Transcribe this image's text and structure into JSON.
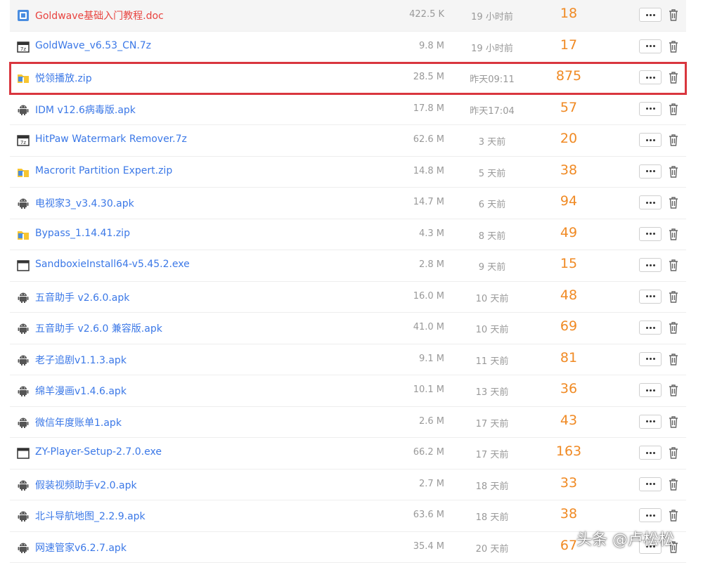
{
  "files": [
    {
      "name": "Goldwave基础入门教程.doc",
      "size": "422.5 K",
      "time": "19 小时前",
      "count": "18",
      "icon": "doc-icon",
      "color": "red"
    },
    {
      "name": "GoldWave_v6.53_CN.7z",
      "size": "9.8 M",
      "time": "19 小时前",
      "count": "17",
      "icon": "archive-7z-icon"
    },
    {
      "name": "悦领播放.zip",
      "size": "28.5 M",
      "time": "昨天09:11",
      "count": "875",
      "icon": "zip-folder-icon",
      "highlighted": true
    },
    {
      "name": "IDM v12.6病毒版.apk",
      "size": "17.8 M",
      "time": "昨天17:04",
      "count": "57",
      "icon": "android-icon"
    },
    {
      "name": "HitPaw Watermark Remover.7z",
      "size": "62.6 M",
      "time": "3 天前",
      "count": "20",
      "icon": "archive-7z-icon"
    },
    {
      "name": "Macrorit Partition Expert.zip",
      "size": "14.8 M",
      "time": "5 天前",
      "count": "38",
      "icon": "zip-folder-icon"
    },
    {
      "name": "电视家3_v3.4.30.apk",
      "size": "14.7 M",
      "time": "6 天前",
      "count": "94",
      "icon": "android-icon"
    },
    {
      "name": "Bypass_1.14.41.zip",
      "size": "4.3 M",
      "time": "8 天前",
      "count": "49",
      "icon": "zip-folder-icon"
    },
    {
      "name": "SandboxieInstall64-v5.45.2.exe",
      "size": "2.8 M",
      "time": "9 天前",
      "count": "15",
      "icon": "exe-window-icon"
    },
    {
      "name": "五音助手 v2.6.0.apk",
      "size": "16.0 M",
      "time": "10 天前",
      "count": "48",
      "icon": "android-icon"
    },
    {
      "name": "五音助手 v2.6.0 兼容版.apk",
      "size": "41.0 M",
      "time": "10 天前",
      "count": "69",
      "icon": "android-icon"
    },
    {
      "name": "老子追剧v1.1.3.apk",
      "size": "9.1 M",
      "time": "11 天前",
      "count": "81",
      "icon": "android-icon"
    },
    {
      "name": "绵羊漫画v1.4.6.apk",
      "size": "10.1 M",
      "time": "13 天前",
      "count": "36",
      "icon": "android-icon"
    },
    {
      "name": "微信年度账单1.apk",
      "size": "2.6 M",
      "time": "17 天前",
      "count": "43",
      "icon": "android-icon"
    },
    {
      "name": "ZY-Player-Setup-2.7.0.exe",
      "size": "66.2 M",
      "time": "17 天前",
      "count": "163",
      "icon": "exe-window-icon"
    },
    {
      "name": "假装视频助手v2.0.apk",
      "size": "2.7 M",
      "time": "18 天前",
      "count": "33",
      "icon": "android-icon"
    },
    {
      "name": "北斗导航地图_2.2.9.apk",
      "size": "63.6 M",
      "time": "18 天前",
      "count": "38",
      "icon": "android-icon"
    },
    {
      "name": "网速管家v6.2.7.apk",
      "size": "35.4 M",
      "time": "20 天前",
      "count": "67",
      "icon": "android-icon"
    }
  ],
  "watermark": "头条 @卢松松",
  "colors": {
    "link": "#3b78e7",
    "red_link": "#e8433f",
    "count": "#f08a24",
    "highlight_border": "#d9363e",
    "meta": "#999999"
  }
}
